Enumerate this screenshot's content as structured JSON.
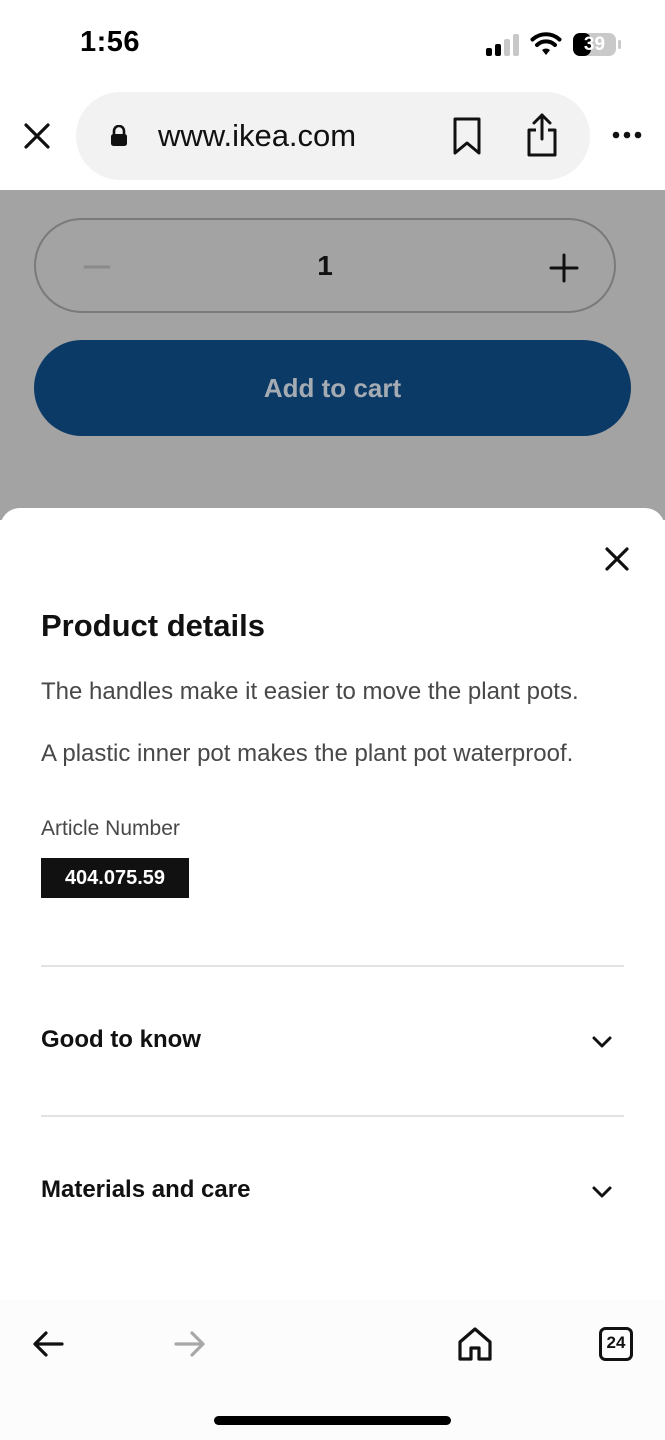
{
  "status_bar": {
    "time": "1:56",
    "battery_level": "39",
    "icons": [
      "signal-icon",
      "wifi-icon",
      "battery-icon"
    ]
  },
  "browser": {
    "url": "www.ikea.com",
    "icons": [
      "close-icon",
      "lock-icon",
      "bookmark-icon",
      "share-icon",
      "more-icon"
    ]
  },
  "product": {
    "quantity": "1",
    "add_to_cart_label": "Add to cart",
    "brand_color": "#0b3a66"
  },
  "details_sheet": {
    "title": "Product details",
    "description": [
      "The handles make it easier to move the plant pots.",
      "A plastic inner pot makes the plant pot waterproof."
    ],
    "article_label": "Article Number",
    "article_number": "404.075.59",
    "sections": [
      {
        "label": "Good to know",
        "icon": "chevron-down-icon"
      },
      {
        "label": "Materials and care",
        "icon": "chevron-down-icon"
      }
    ]
  },
  "toolbar": {
    "tab_count": "24",
    "icons": [
      "back-arrow-icon",
      "forward-arrow-icon",
      "home-icon",
      "tabs-icon"
    ]
  }
}
